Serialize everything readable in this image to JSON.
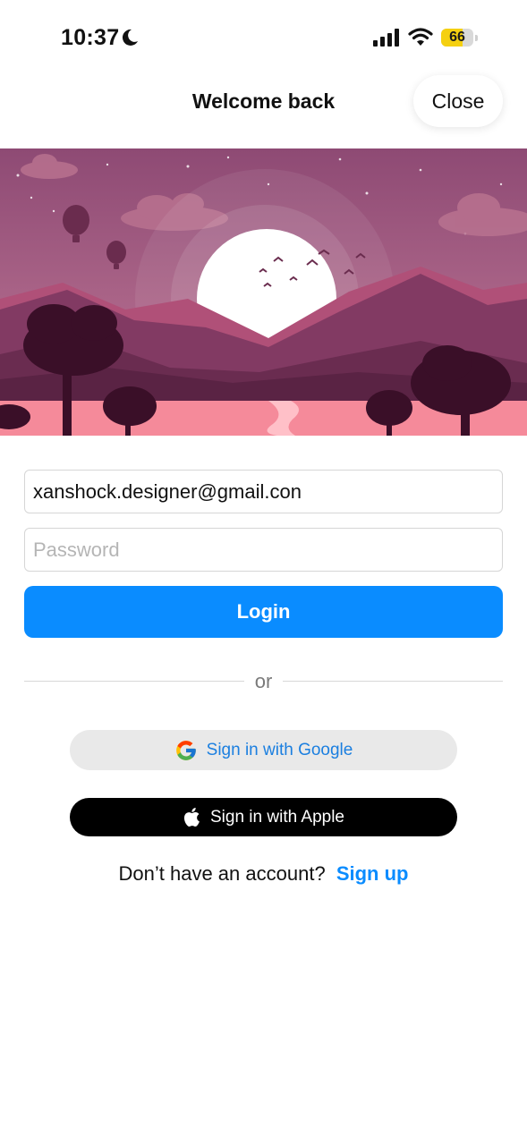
{
  "status_bar": {
    "time": "10:37",
    "battery": "66",
    "battery_level": 0.66
  },
  "header": {
    "title": "Welcome back",
    "close_label": "Close"
  },
  "form": {
    "email_value": "xanshock.designer@gmail.con",
    "password_placeholder": "Password",
    "login_label": "Login"
  },
  "divider": {
    "text": "or"
  },
  "social": {
    "google_label": "Sign in with Google",
    "apple_label": "Sign in with Apple"
  },
  "signup": {
    "prompt": "Don’t have an account?",
    "link": "Sign up"
  },
  "colors": {
    "accent": "#0a8cff",
    "google_text": "#1b7fe0",
    "hero_sky": "#a05a82",
    "hero_water": "#f58a9a"
  }
}
